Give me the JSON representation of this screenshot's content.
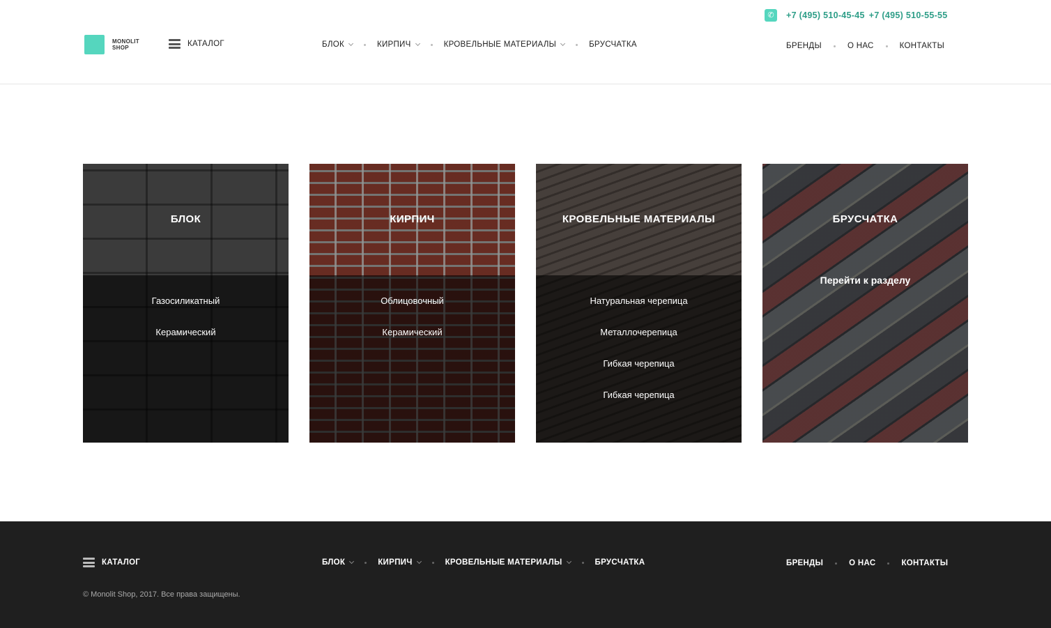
{
  "header": {
    "logo": {
      "line1": "MONOLIT",
      "line2": "SHOP",
      "color": "#55d6be"
    },
    "catalog_label": "КАТАЛОГ",
    "nav": [
      {
        "label": "БЛОК",
        "has_dropdown": true
      },
      {
        "label": "КИРПИЧ",
        "has_dropdown": true
      },
      {
        "label": "КРОВЕЛЬНЫЕ МАТЕРИАЛЫ",
        "has_dropdown": true
      },
      {
        "label": "БРУСЧАТКА",
        "has_dropdown": false
      }
    ],
    "right_nav": [
      {
        "label": "БРЕНДЫ"
      },
      {
        "label": "О НАС"
      },
      {
        "label": "КОНТАКТЫ"
      }
    ],
    "phone_icon": "phone-icon",
    "phones": [
      "+7 (495) 510-45-45",
      "+7 (495) 510-55-55"
    ],
    "accent_color": "#55d6be",
    "phone_color": "#2e9e88"
  },
  "cards": [
    {
      "title": "БЛОК",
      "links": [
        "Газосиликатный",
        "Керамический"
      ]
    },
    {
      "title": "КИРПИЧ",
      "links": [
        "Облицовочный",
        "Керамический"
      ]
    },
    {
      "title": "КРОВЕЛЬНЫЕ МАТЕРИАЛЫ",
      "links": [
        "Натуральная черепица",
        "Металлочерепица",
        "Гибкая черепица",
        "Гибкая черепица"
      ]
    },
    {
      "title": "БРУСЧАТКА",
      "goto_label": "Перейти к разделу"
    }
  ],
  "footer": {
    "catalog_label": "КАТАЛОГ",
    "nav": [
      {
        "label": "БЛОК",
        "has_dropdown": true
      },
      {
        "label": "КИРПИЧ",
        "has_dropdown": true
      },
      {
        "label": "КРОВЕЛЬНЫЕ МАТЕРИАЛЫ",
        "has_dropdown": true
      },
      {
        "label": "БРУСЧАТКА",
        "has_dropdown": false
      }
    ],
    "right_nav": [
      {
        "label": "БРЕНДЫ"
      },
      {
        "label": "О НАС"
      },
      {
        "label": "КОНТАКТЫ"
      }
    ],
    "copyright": "© Monolit Shop, 2017. Все права защищены.",
    "background": "#1f1f1f"
  }
}
